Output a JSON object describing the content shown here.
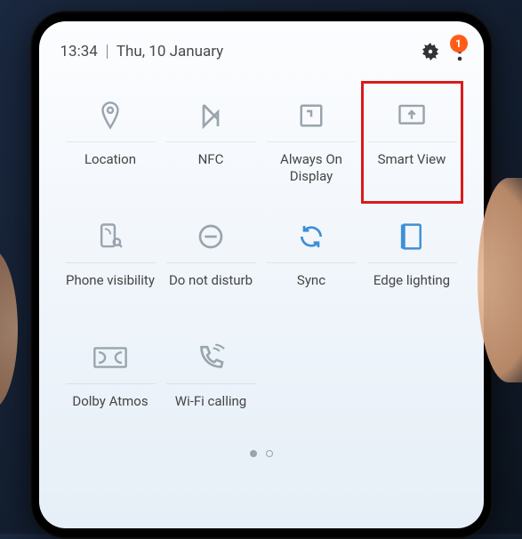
{
  "status": {
    "time": "13:34",
    "date": "Thu, 10 January",
    "badge_count": "1"
  },
  "highlighted_tile": "smart-view",
  "tiles": [
    {
      "id": "location",
      "label": "Location",
      "icon": "pin"
    },
    {
      "id": "nfc",
      "label": "NFC",
      "icon": "nfc"
    },
    {
      "id": "aod",
      "label": "Always On Display",
      "icon": "clock-square"
    },
    {
      "id": "smart-view",
      "label": "Smart View",
      "icon": "cast"
    },
    {
      "id": "phone-vis",
      "label": "Phone visibility",
      "icon": "phone-search"
    },
    {
      "id": "dnd",
      "label": "Do not disturb",
      "icon": "minus-circle"
    },
    {
      "id": "sync",
      "label": "Sync",
      "icon": "sync",
      "accent": true
    },
    {
      "id": "edge-light",
      "label": "Edge lighting",
      "icon": "edge",
      "accent": true
    },
    {
      "id": "dolby",
      "label": "Dolby Atmos",
      "icon": "dolby"
    },
    {
      "id": "wifi-call",
      "label": "Wi-Fi calling",
      "icon": "wifi-call"
    }
  ],
  "pager": {
    "pages": 2,
    "active": 0
  }
}
